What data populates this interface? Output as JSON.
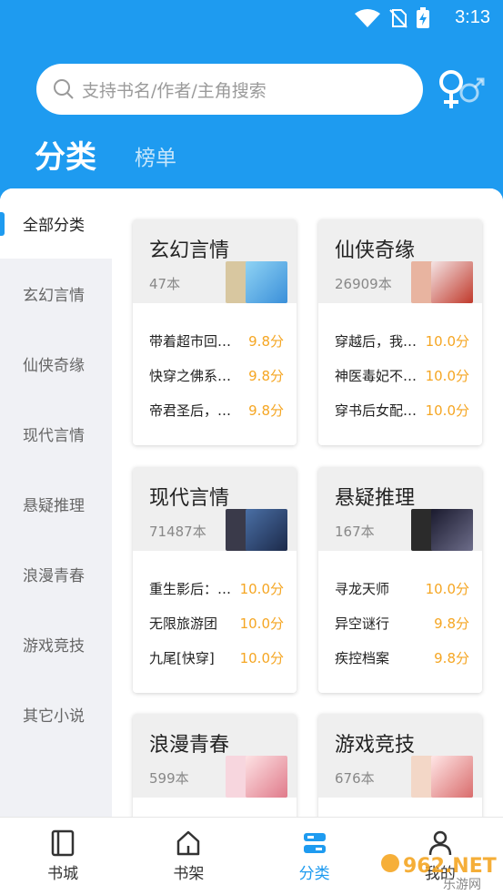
{
  "status": {
    "time": "3:13"
  },
  "search": {
    "placeholder": "支持书名/作者/主角搜索"
  },
  "tabs": {
    "active": "分类",
    "inactive": "榜单"
  },
  "sidebar": {
    "items": [
      {
        "label": "全部分类"
      },
      {
        "label": "玄幻言情"
      },
      {
        "label": "仙侠奇缘"
      },
      {
        "label": "现代言情"
      },
      {
        "label": "悬疑推理"
      },
      {
        "label": "浪漫青春"
      },
      {
        "label": "游戏竞技"
      },
      {
        "label": "其它小说"
      }
    ]
  },
  "cards": [
    {
      "title": "玄幻言情",
      "count": "47本",
      "books": [
        {
          "name": "带着超市回…",
          "score": "9.8分"
        },
        {
          "name": "快穿之佛系…",
          "score": "9.8分"
        },
        {
          "name": "帝君圣后，…",
          "score": "9.8分"
        }
      ]
    },
    {
      "title": "仙侠奇缘",
      "count": "26909本",
      "books": [
        {
          "name": "穿越后，我…",
          "score": "10.0分"
        },
        {
          "name": "神医毒妃不…",
          "score": "10.0分"
        },
        {
          "name": "穿书后女配…",
          "score": "10.0分"
        }
      ]
    },
    {
      "title": "现代言情",
      "count": "71487本",
      "books": [
        {
          "name": "重生影后：…",
          "score": "10.0分"
        },
        {
          "name": "无限旅游团",
          "score": "10.0分"
        },
        {
          "name": "九尾[快穿]",
          "score": "10.0分"
        }
      ]
    },
    {
      "title": "悬疑推理",
      "count": "167本",
      "books": [
        {
          "name": "寻龙天师",
          "score": "10.0分"
        },
        {
          "name": "异空谜行",
          "score": "9.8分"
        },
        {
          "name": "疾控档案",
          "score": "9.8分"
        }
      ]
    },
    {
      "title": "浪漫青春",
      "count": "599本",
      "books": []
    },
    {
      "title": "游戏竞技",
      "count": "676本",
      "books": []
    }
  ],
  "bottom_nav": [
    {
      "label": "书城",
      "icon": "book-icon"
    },
    {
      "label": "书架",
      "icon": "home-icon"
    },
    {
      "label": "分类",
      "icon": "category-icon"
    },
    {
      "label": "我的",
      "icon": "user-icon"
    }
  ],
  "watermark": {
    "text": "962.NET",
    "sub": "乐游网"
  },
  "colors": {
    "primary": "#1e9bf0",
    "score": "#f5a623"
  }
}
